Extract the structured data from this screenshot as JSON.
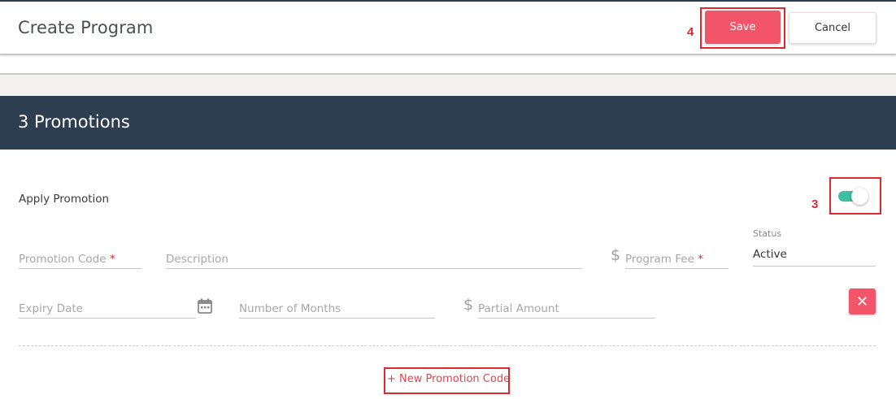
{
  "header": {
    "title": "Create Program",
    "save_label": "Save",
    "cancel_label": "Cancel"
  },
  "annotations": {
    "save_marker": "4",
    "toggle_marker": "3"
  },
  "section": {
    "title": "3 Promotions"
  },
  "promotion": {
    "apply_label": "Apply Promotion",
    "apply_enabled": true,
    "code_placeholder": "Promotion Code",
    "description_placeholder": "Description",
    "currency_symbol": "$",
    "program_fee_placeholder": "Program Fee",
    "required_mark": "*",
    "status_label": "Status",
    "status_value": "Active",
    "expiry_placeholder": "Expiry Date",
    "months_placeholder": "Number of Months",
    "partial_amount_placeholder": "Partial Amount",
    "remove_symbol": "✕",
    "new_code_label": "+ New Promotion Code"
  },
  "colors": {
    "header_dark": "#2d3e50",
    "accent_red": "#f25569",
    "toggle_green": "#3ebfa0",
    "annotation_red": "#e0272f"
  },
  "icons": {
    "calendar": "calendar-icon",
    "close": "close-icon",
    "toggle": "toggle-switch"
  }
}
